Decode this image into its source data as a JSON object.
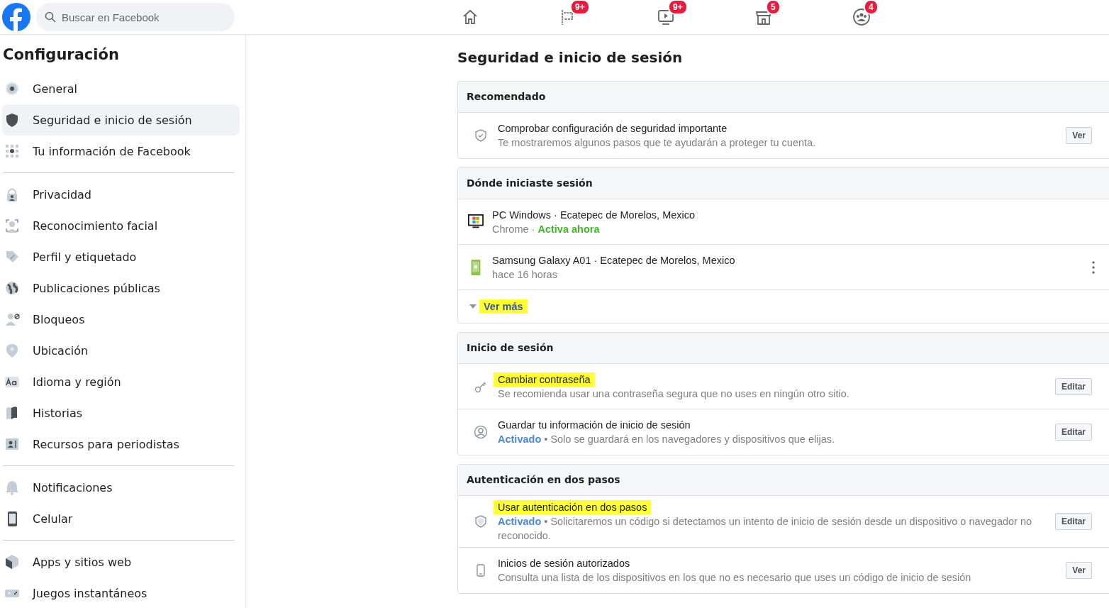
{
  "header": {
    "search": {
      "placeholder": "Buscar en Facebook"
    },
    "nav": [
      {
        "selected": false
      },
      {
        "badge": "9+",
        "selected": false
      },
      {
        "badge": "9+",
        "selected": false
      },
      {
        "badge": "5",
        "selected": false
      },
      {
        "badge": "4",
        "selected": false
      }
    ]
  },
  "sidebar": {
    "title": "Configuración",
    "groups": [
      [
        {
          "label": "General",
          "selected": false
        },
        {
          "label": "Seguridad e inicio de sesión",
          "selected": true
        },
        {
          "label": "Tu información de Facebook",
          "selected": false
        }
      ],
      [
        {
          "label": "Privacidad",
          "selected": false
        },
        {
          "label": "Reconocimiento facial",
          "selected": false
        },
        {
          "label": "Perfil y etiquetado",
          "selected": false
        },
        {
          "label": "Publicaciones públicas",
          "selected": false
        },
        {
          "label": "Bloqueos",
          "selected": false
        },
        {
          "label": "Ubicación",
          "selected": false
        },
        {
          "label": "Idioma y región",
          "selected": false
        },
        {
          "label": "Historias",
          "selected": false
        },
        {
          "label": "Recursos para periodistas",
          "selected": false
        }
      ],
      [
        {
          "label": "Notificaciones",
          "selected": false
        },
        {
          "label": "Celular",
          "selected": false
        }
      ],
      [
        {
          "label": "Apps y sitios web",
          "selected": false
        },
        {
          "label": "Juegos instantáneos",
          "selected": false
        }
      ]
    ]
  },
  "main": {
    "title": "Seguridad e inicio de sesión",
    "sections": [
      {
        "title": "Recomendado",
        "rows": [
          {
            "kind": "setting",
            "title": "Comprobar configuración de seguridad importante",
            "highlighted": false,
            "description": "Te mostraremos algunos pasos que te ayudarán a proteger tu cuenta.",
            "button": "Ver"
          }
        ]
      },
      {
        "title": "Dónde iniciaste sesión",
        "rows": [
          {
            "kind": "session",
            "device": "PC Windows",
            "location": "· Ecatepec de Morelos, Mexico",
            "detail": "Chrome ·",
            "status": "Activa ahora",
            "menu": false
          },
          {
            "kind": "session",
            "device": "Samsung Galaxy A01",
            "location": "· Ecatepec de Morelos, Mexico",
            "detail": "hace 16 horas",
            "menu": true
          },
          {
            "kind": "more",
            "label": "Ver más",
            "highlighted": true
          }
        ]
      },
      {
        "title": "Inicio de sesión",
        "rows": [
          {
            "kind": "setting",
            "title": "Cambiar contraseña",
            "highlighted": true,
            "description": "Se recomienda usar una contraseña segura que no uses en ningún otro sitio.",
            "button": "Editar"
          },
          {
            "kind": "setting",
            "title": "Guardar tu información de inicio de sesión",
            "highlighted": false,
            "status": "Activado",
            "description": "• Solo se guardará en los navegadores y dispositivos que elijas.",
            "button": "Editar"
          }
        ]
      },
      {
        "title": "Autenticación en dos pasos",
        "rows": [
          {
            "kind": "setting",
            "title": "Usar autenticación en dos pasos",
            "highlighted": true,
            "status": "Activado",
            "description": "• Solicitaremos un código si detectamos un intento de inicio de sesión desde un dispositivo o navegador no reconocido.",
            "button": "Editar"
          },
          {
            "kind": "setting",
            "title": "Inicios de sesión autorizados",
            "highlighted": false,
            "description": "Consulta una lista de los dispositivos en los que no es necesario que uses un código de inicio de sesión",
            "button": "Ver"
          }
        ]
      }
    ]
  }
}
